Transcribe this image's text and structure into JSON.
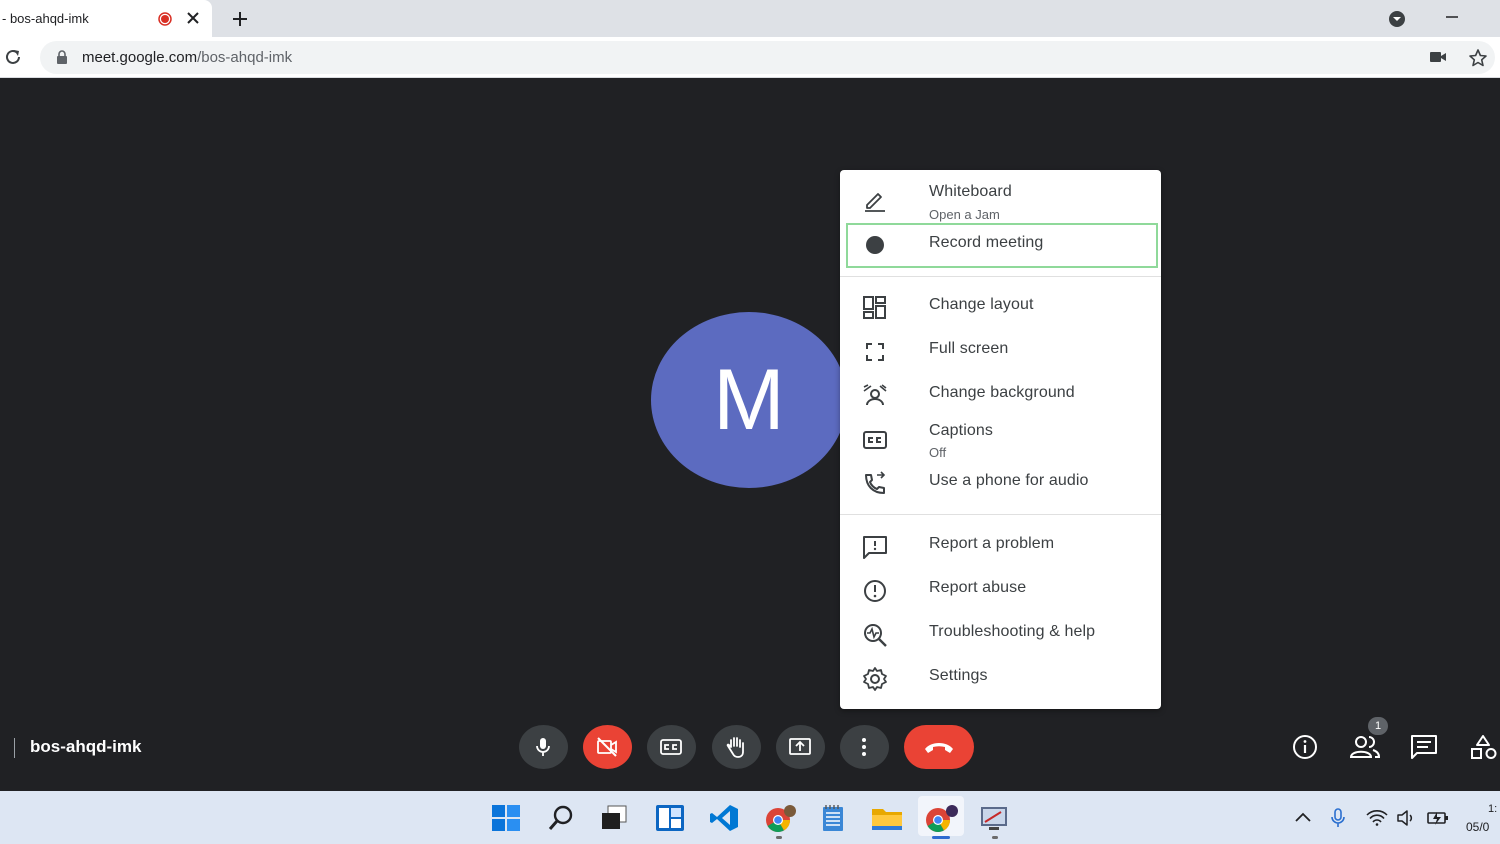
{
  "browser": {
    "tab_title": "- bos-ahqd-imk",
    "url_host": "meet.google.com",
    "url_path": "/bos-ahqd-imk",
    "icons": [
      "recording-dot-icon",
      "close-icon",
      "plus-icon",
      "profile-dropdown-icon",
      "minimize-icon",
      "reload-icon",
      "lock-icon",
      "camera-in-use-icon",
      "star-icon"
    ]
  },
  "participant": {
    "initial": "M",
    "avatar_color": "#5c6bc0"
  },
  "menu": {
    "items": [
      {
        "label": "Whiteboard",
        "sublabel": "Open a Jam",
        "icon": "pen-icon"
      },
      {
        "label": "Record meeting",
        "icon": "record-dot-icon"
      },
      {
        "label": "Change layout",
        "icon": "layout-icon"
      },
      {
        "label": "Full screen",
        "icon": "fullscreen-icon"
      },
      {
        "label": "Change background",
        "icon": "background-icon"
      },
      {
        "label": "Captions",
        "sublabel": "Off",
        "icon": "captions-icon"
      },
      {
        "label": "Use a phone for audio",
        "icon": "phone-icon"
      },
      {
        "label": "Report a problem",
        "icon": "feedback-icon"
      },
      {
        "label": "Report abuse",
        "icon": "alert-icon"
      },
      {
        "label": "Troubleshooting & help",
        "icon": "troubleshoot-icon"
      },
      {
        "label": "Settings",
        "icon": "settings-icon"
      }
    ],
    "highlight_color": "#8fd99a"
  },
  "bottom_bar": {
    "meeting_code": "bos-ahqd-imk",
    "people_count": "1",
    "controls": [
      "mic-icon",
      "camera-off-icon",
      "captions-icon",
      "raise-hand-icon",
      "present-icon",
      "more-options-icon",
      "hangup-icon"
    ],
    "right": [
      "info-icon",
      "people-icon",
      "chat-icon",
      "activities-icon"
    ]
  },
  "taskbar": {
    "time": "1:",
    "date": "05/0",
    "apps": [
      "windows-start-icon",
      "search-icon",
      "task-view-icon",
      "widgets-icon",
      "vscode-icon",
      "chrome-icon",
      "notepad-icon",
      "file-explorer-icon",
      "chrome-active-icon",
      "remote-desktop-icon"
    ],
    "tray": [
      "chevron-up-icon",
      "mic-icon",
      "wifi-icon",
      "volume-icon",
      "battery-icon"
    ]
  },
  "colors": {
    "meet_bg": "#202124",
    "red": "#ea4335",
    "button_gray": "#3c4043"
  }
}
